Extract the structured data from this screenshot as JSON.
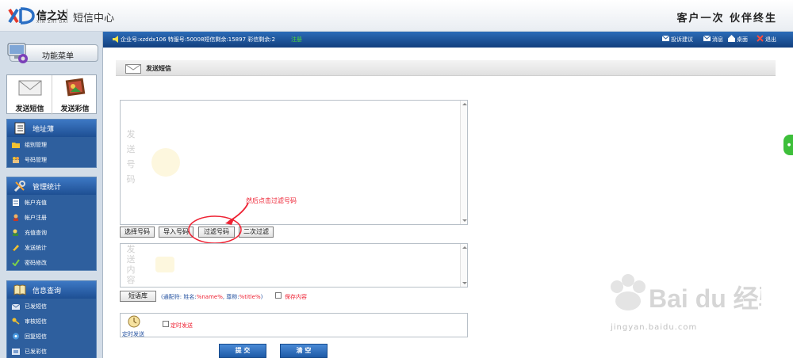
{
  "header": {
    "logo_text": "信之达",
    "logo_sub": "XIN ZHI DA",
    "app_title": "短信中心",
    "slogan": "客户一次 伙伴终生"
  },
  "sidebar": {
    "function_menu": "功能菜单",
    "quick_actions": [
      {
        "label": "发送短信",
        "icon": "envelope-icon"
      },
      {
        "label": "发送彩信",
        "icon": "mms-icon"
      }
    ],
    "sections": [
      {
        "title": "地址薄",
        "icon": "address-book-icon",
        "items": [
          {
            "label": "组别管理",
            "icon": "folder-icon"
          },
          {
            "label": "号码管理",
            "icon": "users-icon"
          }
        ]
      },
      {
        "title": "管理统计",
        "icon": "tools-icon",
        "items": [
          {
            "label": "帐户充值",
            "icon": "document-icon"
          },
          {
            "label": "帐户注册",
            "icon": "user-icon"
          },
          {
            "label": "充值查询",
            "icon": "search-user-icon"
          },
          {
            "label": "发送统计",
            "icon": "pencil-icon"
          },
          {
            "label": "密码修改",
            "icon": "check-icon"
          }
        ]
      },
      {
        "title": "信息查询",
        "icon": "book-icon",
        "items": [
          {
            "label": "已发短信",
            "icon": "sent-icon"
          },
          {
            "label": "审核短信",
            "icon": "key-icon"
          },
          {
            "label": "回复短信",
            "icon": "reply-icon"
          },
          {
            "label": "已发彩信",
            "icon": "sent-mms-icon"
          }
        ]
      }
    ]
  },
  "statusbar": {
    "account_info": "企业号:xzddx106    特服号:50008短信剩余:15897 彩信剩余:2",
    "register_link": "注册",
    "tools": {
      "complaint": "投诉建议",
      "message": "消息",
      "desktop": "桌面",
      "logout": "退出"
    }
  },
  "main": {
    "page_title": "发送短信",
    "numbers_label": "发送号码",
    "content_label": "发送内容",
    "buttons": {
      "select_numbers": "选择号码",
      "import_numbers": "导入号码",
      "filter_numbers": "过滤号码",
      "second_filter": "二次过滤"
    },
    "annotation": "然后点击过滤号码",
    "phrase_library": "短语库",
    "wildcard_prefix": "(通配符: 姓名:",
    "wildcard_name": "%name%",
    "wildcard_mid": ", 尊称:",
    "wildcard_title": "%title%",
    "wildcard_suffix": ")",
    "save_content": "保存内容",
    "schedule_label": "定时发送",
    "schedule_checkbox_label": "定时发送",
    "submit": "提 交",
    "clear": "清 空"
  },
  "watermark": {
    "brand": "Bai du 经验",
    "url": "jingyan.baidu.com"
  },
  "colors": {
    "nav_blue": "#2e5f9e",
    "status_bar": "#1e5aa6",
    "annotation_red": "#e23",
    "register_green": "#4ddc3a"
  }
}
